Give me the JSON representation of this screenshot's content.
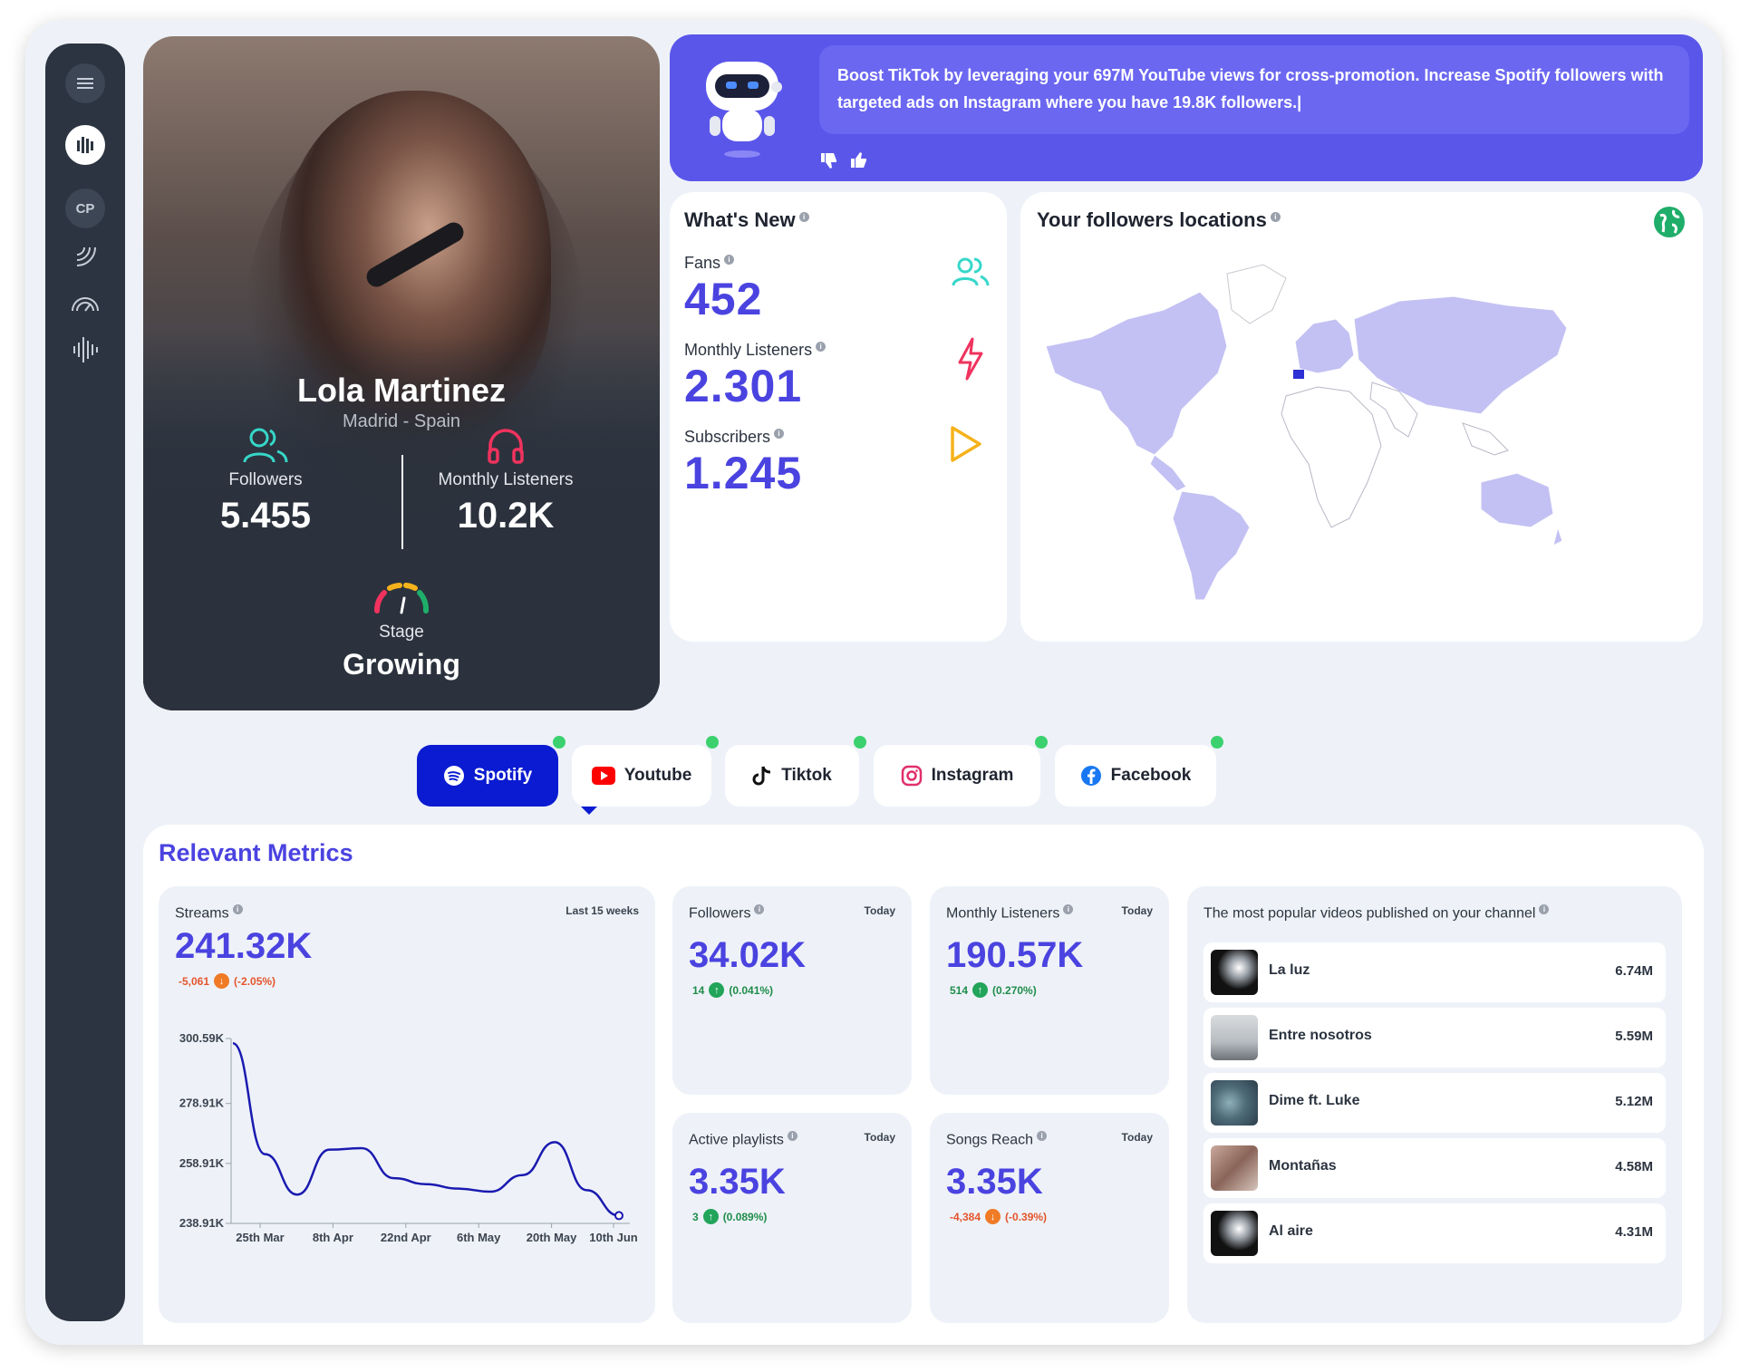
{
  "sidebar": {
    "items": [
      {
        "icon": "menu-icon"
      },
      {
        "icon": "equalizer-icon"
      },
      {
        "label": "CP"
      },
      {
        "icon": "signal-icon"
      },
      {
        "icon": "gauge-icon"
      },
      {
        "icon": "waveform-icon"
      }
    ]
  },
  "profile": {
    "name": "Lola Martinez",
    "location": "Madrid - Spain",
    "followers_label": "Followers",
    "followers_value": "5.455",
    "listeners_label": "Monthly Listeners",
    "listeners_value": "10.2K",
    "stage_label": "Stage",
    "stage_value": "Growing"
  },
  "ai_banner": {
    "text": "Boost TikTok by leveraging your 697M YouTube views for cross-promotion. Increase Spotify followers with targeted ads on Instagram where you have 19.8K followers.|"
  },
  "whats_new": {
    "title": "What's New",
    "items": [
      {
        "label": "Fans",
        "value": "452",
        "icon": "users-icon"
      },
      {
        "label": "Monthly Listeners",
        "value": "2.301",
        "icon": "bolt-icon"
      },
      {
        "label": "Subscribers",
        "value": "1.245",
        "icon": "play-icon"
      }
    ]
  },
  "locations": {
    "title": "Your followers locations",
    "icon": "globe-icon"
  },
  "tabs": [
    {
      "label": "Spotify",
      "active": true
    },
    {
      "label": "Youtube",
      "active": false
    },
    {
      "label": "Tiktok",
      "active": false
    },
    {
      "label": "Instagram",
      "active": false
    },
    {
      "label": "Facebook",
      "active": false
    }
  ],
  "metrics": {
    "title": "Relevant Metrics",
    "streams": {
      "label": "Streams",
      "period": "Last 15 weeks",
      "value": "241.32K",
      "delta": "-5,061",
      "delta_pct": "(-2.05%)"
    },
    "followers": {
      "label": "Followers",
      "period": "Today",
      "value": "34.02K",
      "delta": "14",
      "delta_pct": "(0.041%)"
    },
    "monthly_listeners": {
      "label": "Monthly Listeners",
      "period": "Today",
      "value": "190.57K",
      "delta": "514",
      "delta_pct": "(0.270%)"
    },
    "active_playlists": {
      "label": "Active playlists",
      "period": "Today",
      "value": "3.35K",
      "delta": "3",
      "delta_pct": "(0.089%)"
    },
    "songs_reach": {
      "label": "Songs Reach",
      "period": "Today",
      "value": "3.35K",
      "delta": "-4,384",
      "delta_pct": "(-0.39%)"
    },
    "videos": {
      "title": "The most popular videos published on your channel",
      "items": [
        {
          "title": "La luz",
          "views": "6.74M"
        },
        {
          "title": "Entre nosotros",
          "views": "5.59M"
        },
        {
          "title": "Dime ft. Luke",
          "views": "5.12M"
        },
        {
          "title": "Montañas",
          "views": "4.58M"
        },
        {
          "title": "Al aire",
          "views": "4.31M"
        }
      ]
    }
  },
  "chart_data": {
    "type": "line",
    "x_ticks": [
      "25th Mar",
      "8th Apr",
      "22nd Apr",
      "6th May",
      "20th May",
      "10th Jun"
    ],
    "y_ticks": [
      "238.91K",
      "258.91K",
      "278.91K",
      "300.59K"
    ],
    "ylim": [
      238.91,
      300.59
    ],
    "series": [
      {
        "values": [
          299.0,
          262.0,
          248.5,
          263.5,
          264.0,
          254.0,
          252.0,
          250.5,
          249.5,
          255.0,
          266.0,
          250.0,
          241.5
        ]
      }
    ],
    "colors": {
      "line": "#1a1ab0"
    }
  }
}
